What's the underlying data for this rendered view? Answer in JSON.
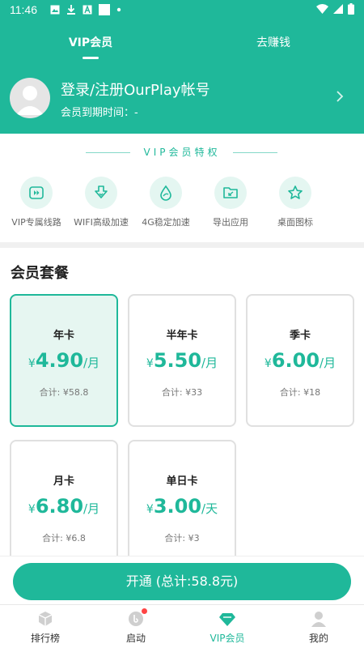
{
  "status_bar": {
    "time": "11:46",
    "icons": [
      "image-icon",
      "download-icon",
      "a-box-icon",
      "square-icon",
      "dot-icon"
    ],
    "right_icons": [
      "wifi-icon",
      "signal-icon",
      "battery-icon"
    ]
  },
  "tabs": {
    "vip": "VIP会员",
    "earn": "去赚钱"
  },
  "profile": {
    "login_text": "登录/注册OurPlay帐号",
    "expire_text": "会员到期时间：-"
  },
  "privileges": {
    "title": "VIP会员特权",
    "items": [
      {
        "label": "VIP专属线路",
        "icon": "fast-forward-icon"
      },
      {
        "label": "WIFI高级加速",
        "icon": "download-arrow-icon"
      },
      {
        "label": "4G稳定加速",
        "icon": "drop-icon"
      },
      {
        "label": "导出应用",
        "icon": "folder-export-icon"
      },
      {
        "label": "桌面图标",
        "icon": "star-icon"
      }
    ]
  },
  "packages": {
    "title": "会员套餐",
    "items": [
      {
        "name": "年卡",
        "currency": "¥",
        "price": "4.90",
        "unit": "/月",
        "total": "合计: ¥58.8",
        "selected": true
      },
      {
        "name": "半年卡",
        "currency": "¥",
        "price": "5.50",
        "unit": "/月",
        "total": "合计: ¥33",
        "selected": false
      },
      {
        "name": "季卡",
        "currency": "¥",
        "price": "6.00",
        "unit": "/月",
        "total": "合计: ¥18",
        "selected": false
      },
      {
        "name": "月卡",
        "currency": "¥",
        "price": "6.80",
        "unit": "/月",
        "total": "合计: ¥6.8",
        "selected": false
      },
      {
        "name": "单日卡",
        "currency": "¥",
        "price": "3.00",
        "unit": "/天",
        "total": "合计: ¥3",
        "selected": false
      }
    ]
  },
  "open_button": "开通 (总计:58.8元)",
  "nav": [
    {
      "label": "排行榜",
      "icon": "cube-icon"
    },
    {
      "label": "启动",
      "icon": "launch-icon",
      "badge": true
    },
    {
      "label": "VIP会员",
      "icon": "diamond-icon",
      "active": true
    },
    {
      "label": "我的",
      "icon": "person-icon"
    }
  ],
  "colors": {
    "brand": "#1fb89a",
    "selected_bg": "#e6f6f1",
    "badge": "#ff4444"
  }
}
